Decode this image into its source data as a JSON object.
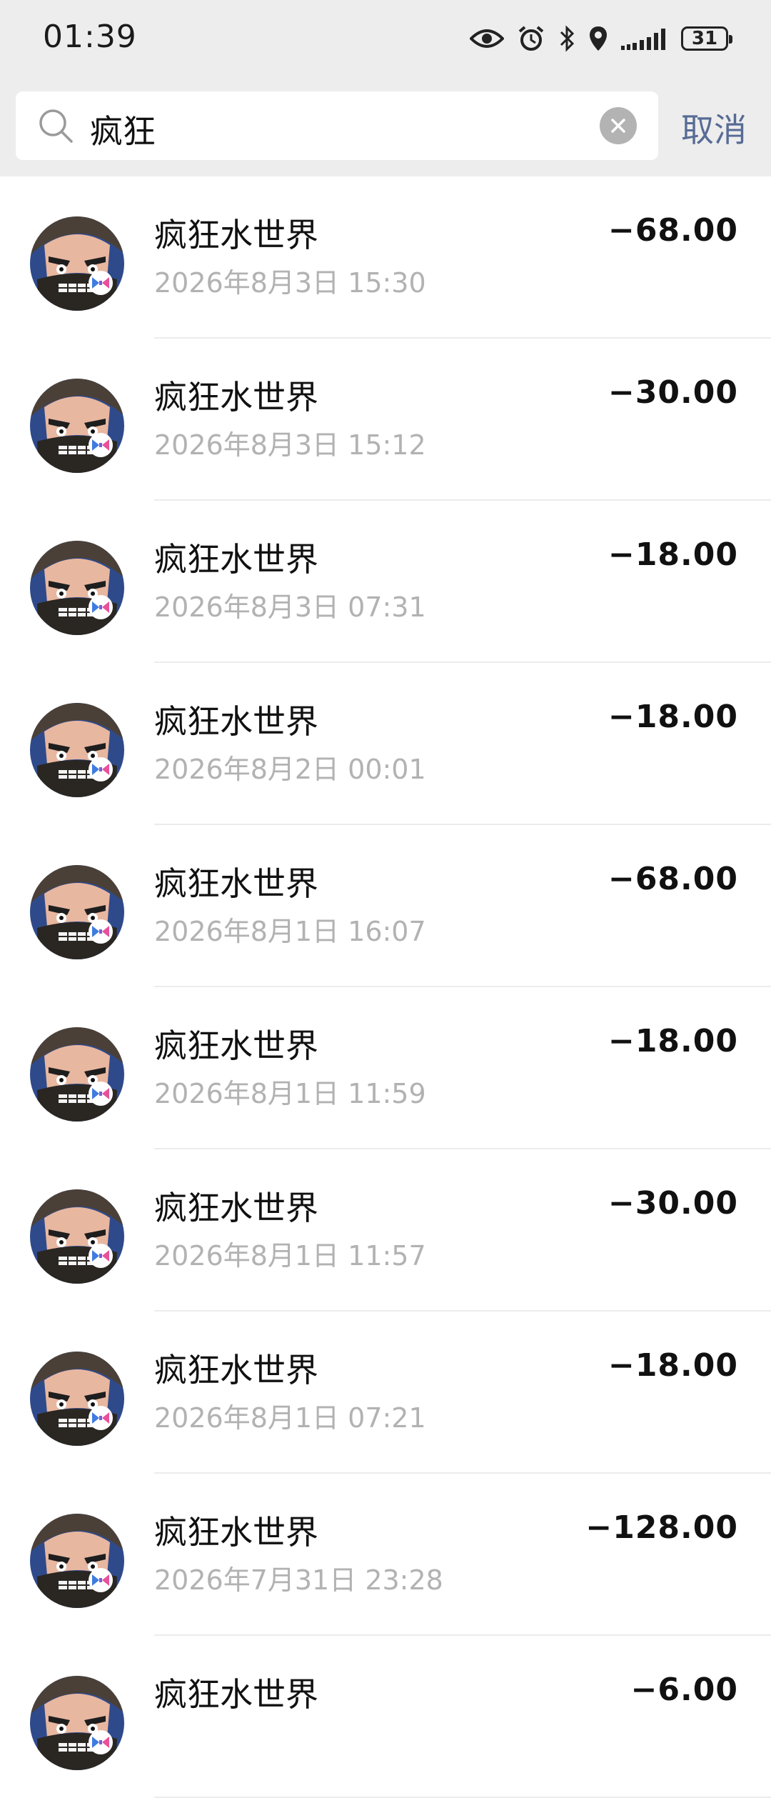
{
  "status_bar": {
    "time": "01:39",
    "icons": [
      "eye-icon",
      "alarm-icon",
      "bluetooth-icon",
      "location-icon",
      "signal-icon",
      "battery-icon"
    ],
    "battery": "31"
  },
  "search": {
    "query": "疯狂",
    "cancel_label": "取消"
  },
  "transactions": [
    {
      "name": "疯狂水世界",
      "date": "2026年8月3日 15:30",
      "amount": "−68.00"
    },
    {
      "name": "疯狂水世界",
      "date": "2026年8月3日 15:12",
      "amount": "−30.00"
    },
    {
      "name": "疯狂水世界",
      "date": "2026年8月3日 07:31",
      "amount": "−18.00"
    },
    {
      "name": "疯狂水世界",
      "date": "2026年8月2日 00:01",
      "amount": "−18.00"
    },
    {
      "name": "疯狂水世界",
      "date": "2026年8月1日 16:07",
      "amount": "−68.00"
    },
    {
      "name": "疯狂水世界",
      "date": "2026年8月1日 11:59",
      "amount": "−18.00"
    },
    {
      "name": "疯狂水世界",
      "date": "2026年8月1日 11:57",
      "amount": "−30.00"
    },
    {
      "name": "疯狂水世界",
      "date": "2026年8月1日 07:21",
      "amount": "−18.00"
    },
    {
      "name": "疯狂水世界",
      "date": "2026年7月31日 23:28",
      "amount": "−128.00"
    },
    {
      "name": "疯狂水世界",
      "date": "",
      "amount": "−6.00"
    }
  ],
  "colors": {
    "header_bg": "#ededed",
    "cancel": "#576b95",
    "secondary_text": "#b2b2b2",
    "badge": "#3f7be0"
  }
}
